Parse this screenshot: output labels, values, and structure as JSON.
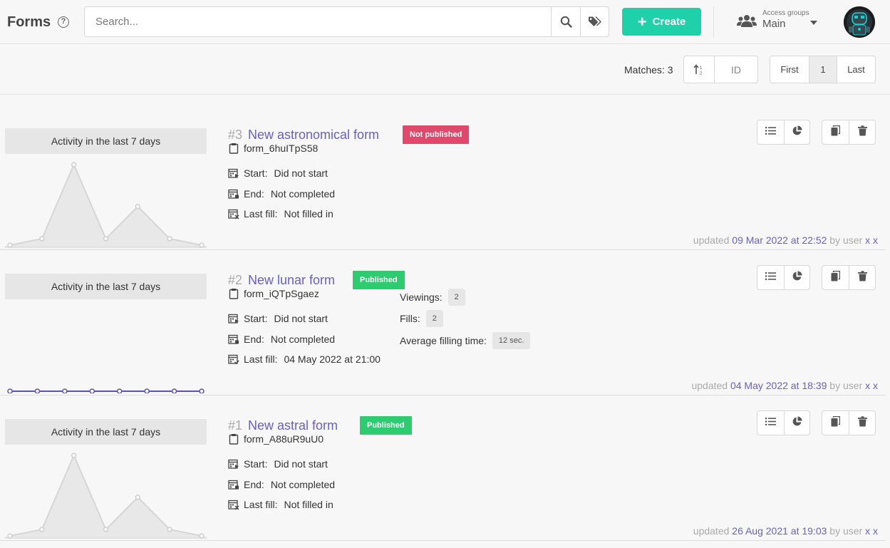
{
  "header": {
    "title": "Forms",
    "search_placeholder": "Search...",
    "create_label": "Create",
    "access_groups_label": "Access groups",
    "access_group_value": "Main"
  },
  "toolbar": {
    "matches": "Matches: 3",
    "sort_field": "ID",
    "pager": {
      "first": "First",
      "current": "1",
      "last": "Last"
    }
  },
  "forms": [
    {
      "number": "#3",
      "title": "New astronomical form",
      "status": "Not published",
      "status_color": "#e0496c",
      "code": "form_6huITpS58",
      "activity_label": "Activity in the last 7 days",
      "activity": [
        0,
        2,
        25,
        2,
        12,
        2,
        0
      ],
      "start_label": "Start:",
      "start": "Did not start",
      "end_label": "End:",
      "end": "Not completed",
      "last_fill_label": "Last fill:",
      "last_fill": "Not filled in",
      "updated_prefix": "updated",
      "updated_date": "09 Mar 2022 at 22:52",
      "updated_by": "by user",
      "updated_user": "x x"
    },
    {
      "number": "#2",
      "title": "New lunar form",
      "status": "Published",
      "status_color": "#2ecc71",
      "code": "form_iQTpSgaez",
      "activity_label": "Activity in the last 7 days",
      "activity": [
        0,
        0,
        0,
        0,
        0,
        0,
        0,
        0
      ],
      "start_label": "Start:",
      "start": "Did not start",
      "end_label": "End:",
      "end": "Not completed",
      "last_fill_label": "Last fill:",
      "last_fill": "04 May 2022 at 21:00",
      "stats": {
        "viewings_label": "Viewings:",
        "viewings": "2",
        "fills_label": "Fills:",
        "fills": "2",
        "avg_label": "Average filling time:",
        "avg": "12 sec."
      },
      "updated_prefix": "updated",
      "updated_date": "04 May 2022 at 18:39",
      "updated_by": "by user",
      "updated_user": "x x"
    },
    {
      "number": "#1",
      "title": "New astral form",
      "status": "Published",
      "status_color": "#2ecc71",
      "code": "form_A88uR9uU0",
      "activity_label": "Activity in the last 7 days",
      "activity": [
        0,
        2,
        25,
        2,
        12,
        2,
        0
      ],
      "start_label": "Start:",
      "start": "Did not start",
      "end_label": "End:",
      "end": "Not completed",
      "last_fill_label": "Last fill:",
      "last_fill": "Not filled in",
      "updated_prefix": "updated",
      "updated_date": "26 Aug 2021 at 19:03",
      "updated_by": "by user",
      "updated_user": "x x"
    }
  ],
  "colors": {
    "accent": "#1fd1a8",
    "link": "#6a5fc7",
    "line_series": "#5a4fcf"
  }
}
